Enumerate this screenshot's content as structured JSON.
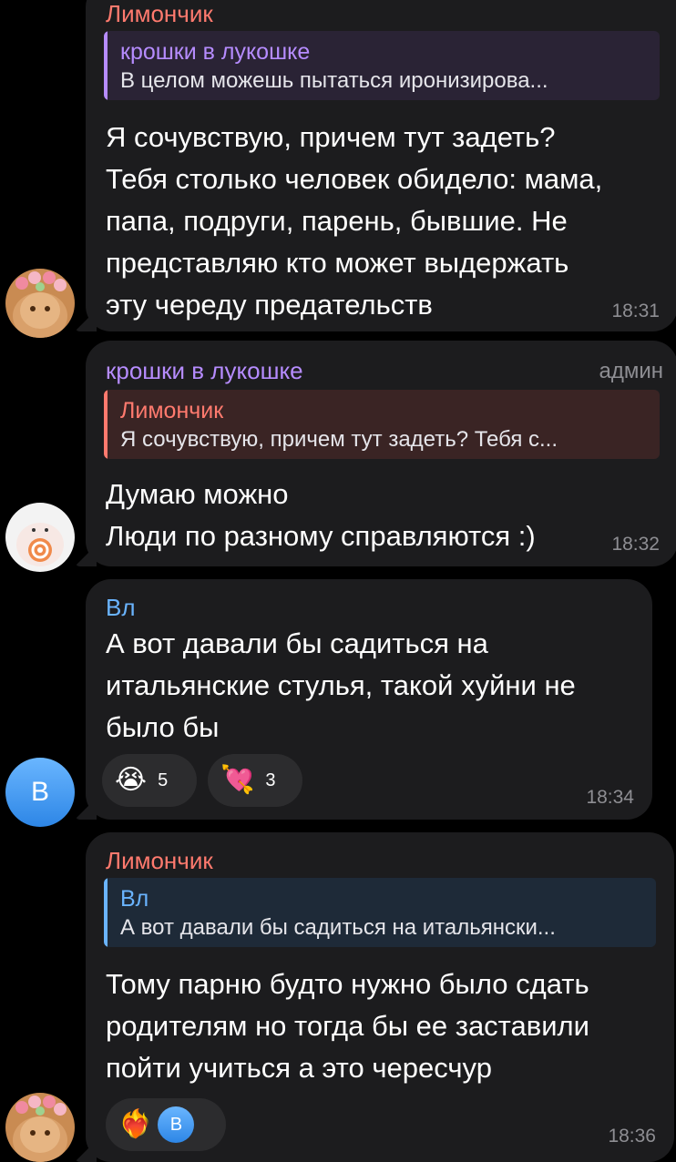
{
  "messages": [
    {
      "sender": "Лимончик",
      "reply": {
        "name": "крошки в лукошке",
        "text": "В целом можешь пытаться иронизирова..."
      },
      "lines": [
        "Я сочувствую, причем тут задеть?",
        "Тебя столько человек обидело: мама,",
        "папа, подруги, парень, бывшие. Не",
        "представляю кто может выдержать",
        "эту череду предательств"
      ],
      "time": "18:31"
    },
    {
      "sender": "крошки в лукошке",
      "badge": "админ",
      "reply": {
        "name": "Лимончик",
        "text": "Я сочувствую, причем тут задеть? Тебя с..."
      },
      "lines": [
        "Думаю можно",
        "Люди по разному справляются :)"
      ],
      "time": "18:32"
    },
    {
      "sender": "Вл",
      "lines": [
        "А вот давали бы садиться на",
        "итальянские стулья, такой хуйни не",
        "было бы"
      ],
      "reactions": [
        {
          "emoji": "😭",
          "count": "5"
        },
        {
          "emoji": "💘",
          "count": "3"
        }
      ],
      "time": "18:34",
      "avatar_letter": "В"
    },
    {
      "sender": "Лимончик",
      "reply": {
        "name": "Вл",
        "text": "А вот давали бы садиться на итальянски..."
      },
      "lines": [
        "Тому парню будто нужно было сдать",
        "родителям но тогда бы ее заставили",
        "пойти учиться а это чересчур"
      ],
      "reactions": [
        {
          "emoji": "❤️‍🔥",
          "reactor": "В"
        }
      ],
      "time": "18:36"
    }
  ],
  "colors": {
    "limonchik": "#ff7a6e",
    "kroshki": "#b68cff",
    "vl": "#6ab4ff",
    "bubble": "#1c1c1e"
  }
}
